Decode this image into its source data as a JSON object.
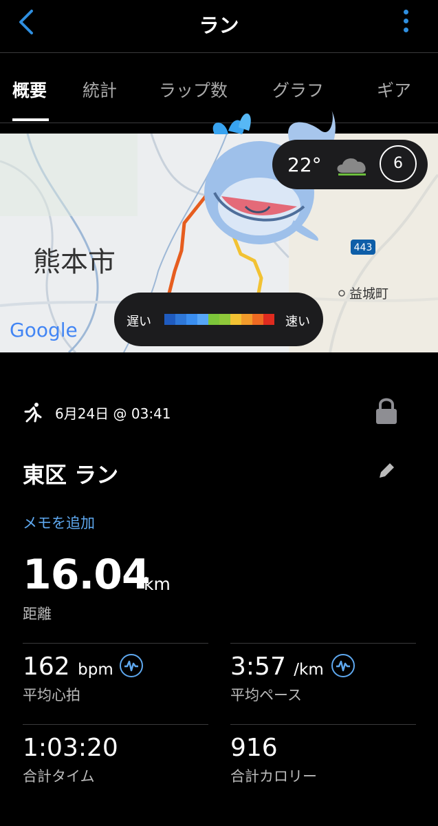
{
  "header": {
    "title": "ラン"
  },
  "tabs": [
    "概要",
    "統計",
    "ラップ数",
    "グラフ",
    "ギア"
  ],
  "map": {
    "city_label": "熊本市",
    "town_label": "益城町",
    "route_number": "443",
    "google_label": "Google",
    "weather_temp": "22°",
    "wind_value": "6",
    "legend_slow": "遅い",
    "legend_fast": "速い",
    "legend_colors": [
      "#1f5bbf",
      "#2e77d8",
      "#3a8ef0",
      "#56a6f7",
      "#7cc53a",
      "#8fc83a",
      "#f2c233",
      "#f29b2b",
      "#ee6a22",
      "#df2b1f"
    ]
  },
  "activity": {
    "date_time": "6月24日 @ 03:41",
    "name": "東区 ラン",
    "add_memo": "メモを追加",
    "distance_value": "16.04",
    "distance_unit": "km",
    "distance_label": "距離"
  },
  "stats": {
    "avg_hr_value": "162",
    "avg_hr_unit": "bpm",
    "avg_hr_label": "平均心拍",
    "avg_pace_value": "3:57",
    "avg_pace_unit": "/km",
    "avg_pace_label": "平均ペース",
    "total_time_value": "1:03:20",
    "total_time_label": "合計タイム",
    "total_cal_value": "916",
    "total_cal_label": "合計カロリー"
  }
}
